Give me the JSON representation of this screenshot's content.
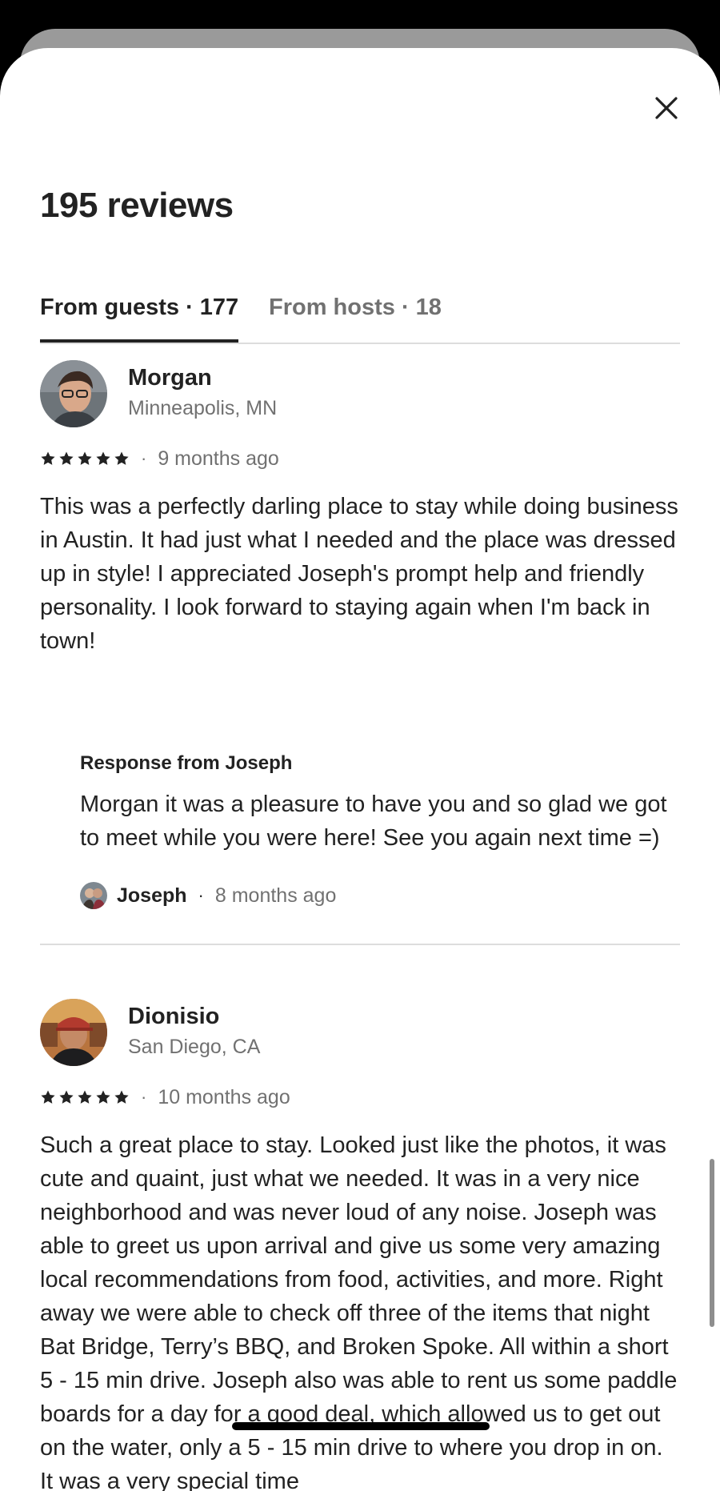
{
  "icons": {
    "close": "close-icon",
    "star": "star-icon"
  },
  "colors": {
    "text": "#222222",
    "muted": "#717171",
    "divider": "#dddddd"
  },
  "header": {
    "title": "195 reviews"
  },
  "tabs": [
    {
      "label": "From guests · 177",
      "active": true
    },
    {
      "label": "From hosts · 18",
      "active": false
    }
  ],
  "reviews": [
    {
      "name": "Morgan",
      "location": "Minneapolis, MN",
      "rating": 5,
      "separator": "·",
      "date": "9 months ago",
      "text": "This was a perfectly darling place to stay while doing business in Austin. It had just what I needed and the place was dressed up in style! I appreciated Joseph's prompt help and friendly personality. I look forward to staying again when I'm back in town!",
      "response": {
        "title": "Response from Joseph",
        "text": "Morgan it was a pleasure to have you and so glad we got to meet while you were here! See you again next time =)",
        "author": "Joseph",
        "separator": "·",
        "date": "8 months ago"
      }
    },
    {
      "name": "Dionisio",
      "location": "San Diego, CA",
      "rating": 5,
      "separator": "·",
      "date": "10 months ago",
      "text": "Such a great place to stay. Looked just like the photos, it was cute and quaint, just what we needed. It was in a very nice neighborhood and was never loud of any noise. Joseph was able to greet us upon arrival and give us some very amazing local recommendations from food, activities, and more. Right away we were able to check off three of the items that night Bat Bridge, Terry’s BBQ, and Broken Spoke. All within a short 5 - 15 min drive. Joseph also was able to rent us some paddle boards for a day for a good deal, which allowed us to get out on the water, only a 5 - 15 min drive to where you drop in on. It was a very special time"
    }
  ]
}
